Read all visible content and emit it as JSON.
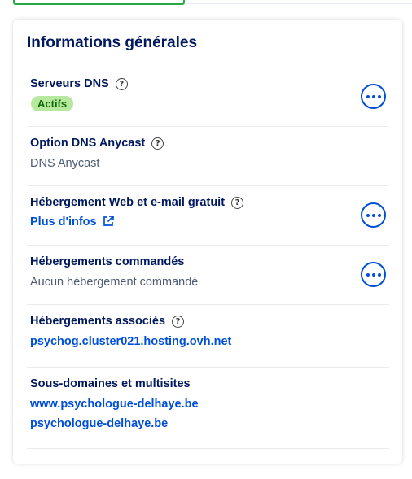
{
  "card": {
    "title": "Informations générales",
    "dns_servers": {
      "label": "Serveurs DNS",
      "status": "Actifs"
    },
    "anycast": {
      "label": "Option DNS Anycast",
      "value": "DNS Anycast"
    },
    "free_hosting": {
      "label": "Hébergement Web et e-mail gratuit",
      "link": "Plus d'infos"
    },
    "ordered_hosting": {
      "label": "Hébergements commandés",
      "value": "Aucun hébergement commandé"
    },
    "associated_hosting": {
      "label": "Hébergements associés",
      "link": "psychog.cluster021.hosting.ovh.net"
    },
    "subdomains": {
      "label": "Sous-domaines et multisites",
      "links": [
        "www.psychologue-delhaye.be",
        "psychologue-delhaye.be"
      ]
    }
  },
  "colors": {
    "accent": "#0050d7",
    "title": "#00185e",
    "badge_bg": "#b6e8a0",
    "badge_text": "#0e6a00"
  },
  "icons": {
    "help": "help-circle-icon",
    "more": "ellipsis-icon",
    "external": "external-link-icon"
  }
}
